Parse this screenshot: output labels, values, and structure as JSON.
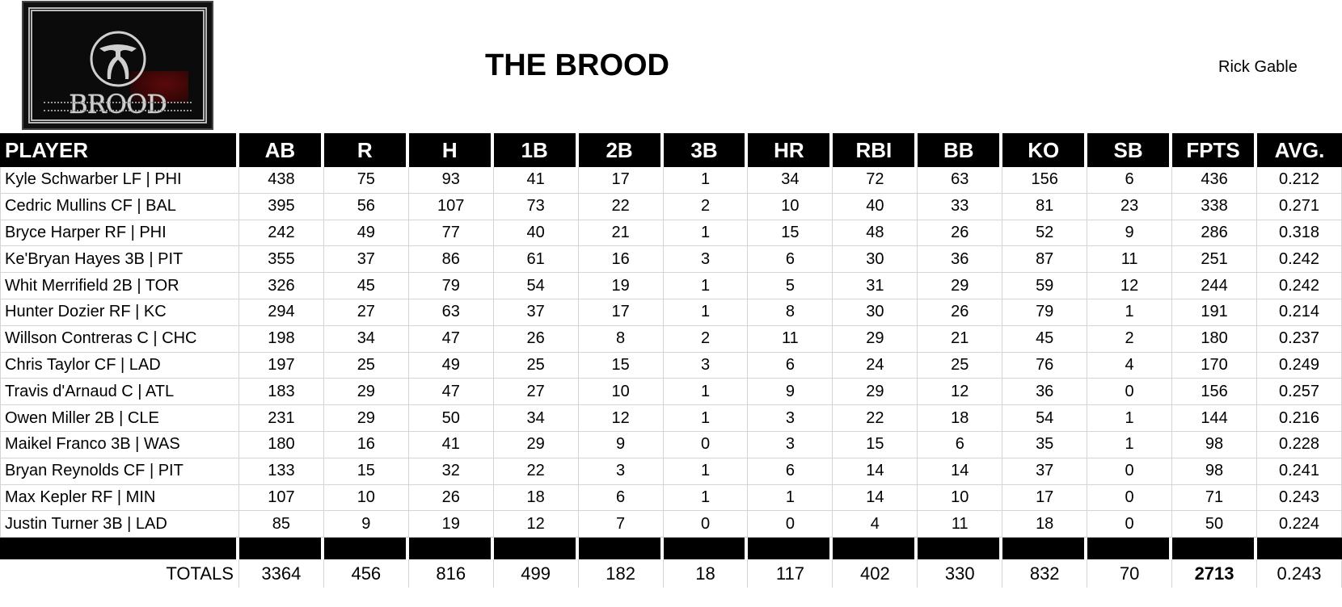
{
  "header": {
    "logo_text": "BROOD",
    "title": "THE BROOD",
    "owner": "Rick Gable"
  },
  "colors": {
    "header_bg": "#000000",
    "header_text": "#ffffff",
    "grid_line": "#d4d4d4",
    "logo_stain": "#5a0a0a"
  },
  "table": {
    "columns": [
      "PLAYER",
      "AB",
      "R",
      "H",
      "1B",
      "2B",
      "3B",
      "HR",
      "RBI",
      "BB",
      "KO",
      "SB",
      "FPTS",
      "AVG."
    ],
    "rows": [
      [
        "Kyle Schwarber LF | PHI",
        "438",
        "75",
        "93",
        "41",
        "17",
        "1",
        "34",
        "72",
        "63",
        "156",
        "6",
        "436",
        "0.212"
      ],
      [
        "Cedric Mullins CF | BAL",
        "395",
        "56",
        "107",
        "73",
        "22",
        "2",
        "10",
        "40",
        "33",
        "81",
        "23",
        "338",
        "0.271"
      ],
      [
        "Bryce Harper RF | PHI",
        "242",
        "49",
        "77",
        "40",
        "21",
        "1",
        "15",
        "48",
        "26",
        "52",
        "9",
        "286",
        "0.318"
      ],
      [
        "Ke'Bryan Hayes 3B | PIT",
        "355",
        "37",
        "86",
        "61",
        "16",
        "3",
        "6",
        "30",
        "36",
        "87",
        "11",
        "251",
        "0.242"
      ],
      [
        "Whit Merrifield 2B | TOR",
        "326",
        "45",
        "79",
        "54",
        "19",
        "1",
        "5",
        "31",
        "29",
        "59",
        "12",
        "244",
        "0.242"
      ],
      [
        "Hunter Dozier RF | KC",
        "294",
        "27",
        "63",
        "37",
        "17",
        "1",
        "8",
        "30",
        "26",
        "79",
        "1",
        "191",
        "0.214"
      ],
      [
        "Willson Contreras C | CHC",
        "198",
        "34",
        "47",
        "26",
        "8",
        "2",
        "11",
        "29",
        "21",
        "45",
        "2",
        "180",
        "0.237"
      ],
      [
        "Chris Taylor CF | LAD",
        "197",
        "25",
        "49",
        "25",
        "15",
        "3",
        "6",
        "24",
        "25",
        "76",
        "4",
        "170",
        "0.249"
      ],
      [
        "Travis d'Arnaud C | ATL",
        "183",
        "29",
        "47",
        "27",
        "10",
        "1",
        "9",
        "29",
        "12",
        "36",
        "0",
        "156",
        "0.257"
      ],
      [
        "Owen Miller 2B | CLE",
        "231",
        "29",
        "50",
        "34",
        "12",
        "1",
        "3",
        "22",
        "18",
        "54",
        "1",
        "144",
        "0.216"
      ],
      [
        "Maikel Franco 3B | WAS",
        "180",
        "16",
        "41",
        "29",
        "9",
        "0",
        "3",
        "15",
        "6",
        "35",
        "1",
        "98",
        "0.228"
      ],
      [
        "Bryan Reynolds CF | PIT",
        "133",
        "15",
        "32",
        "22",
        "3",
        "1",
        "6",
        "14",
        "14",
        "37",
        "0",
        "98",
        "0.241"
      ],
      [
        "Max Kepler RF | MIN",
        "107",
        "10",
        "26",
        "18",
        "6",
        "1",
        "1",
        "14",
        "10",
        "17",
        "0",
        "71",
        "0.243"
      ],
      [
        "Justin Turner 3B | LAD",
        "85",
        "9",
        "19",
        "12",
        "7",
        "0",
        "0",
        "4",
        "11",
        "18",
        "0",
        "50",
        "0.224"
      ]
    ],
    "totals": [
      "TOTALS",
      "3364",
      "456",
      "816",
      "499",
      "182",
      "18",
      "117",
      "402",
      "330",
      "832",
      "70",
      "2713",
      "0.243"
    ]
  }
}
